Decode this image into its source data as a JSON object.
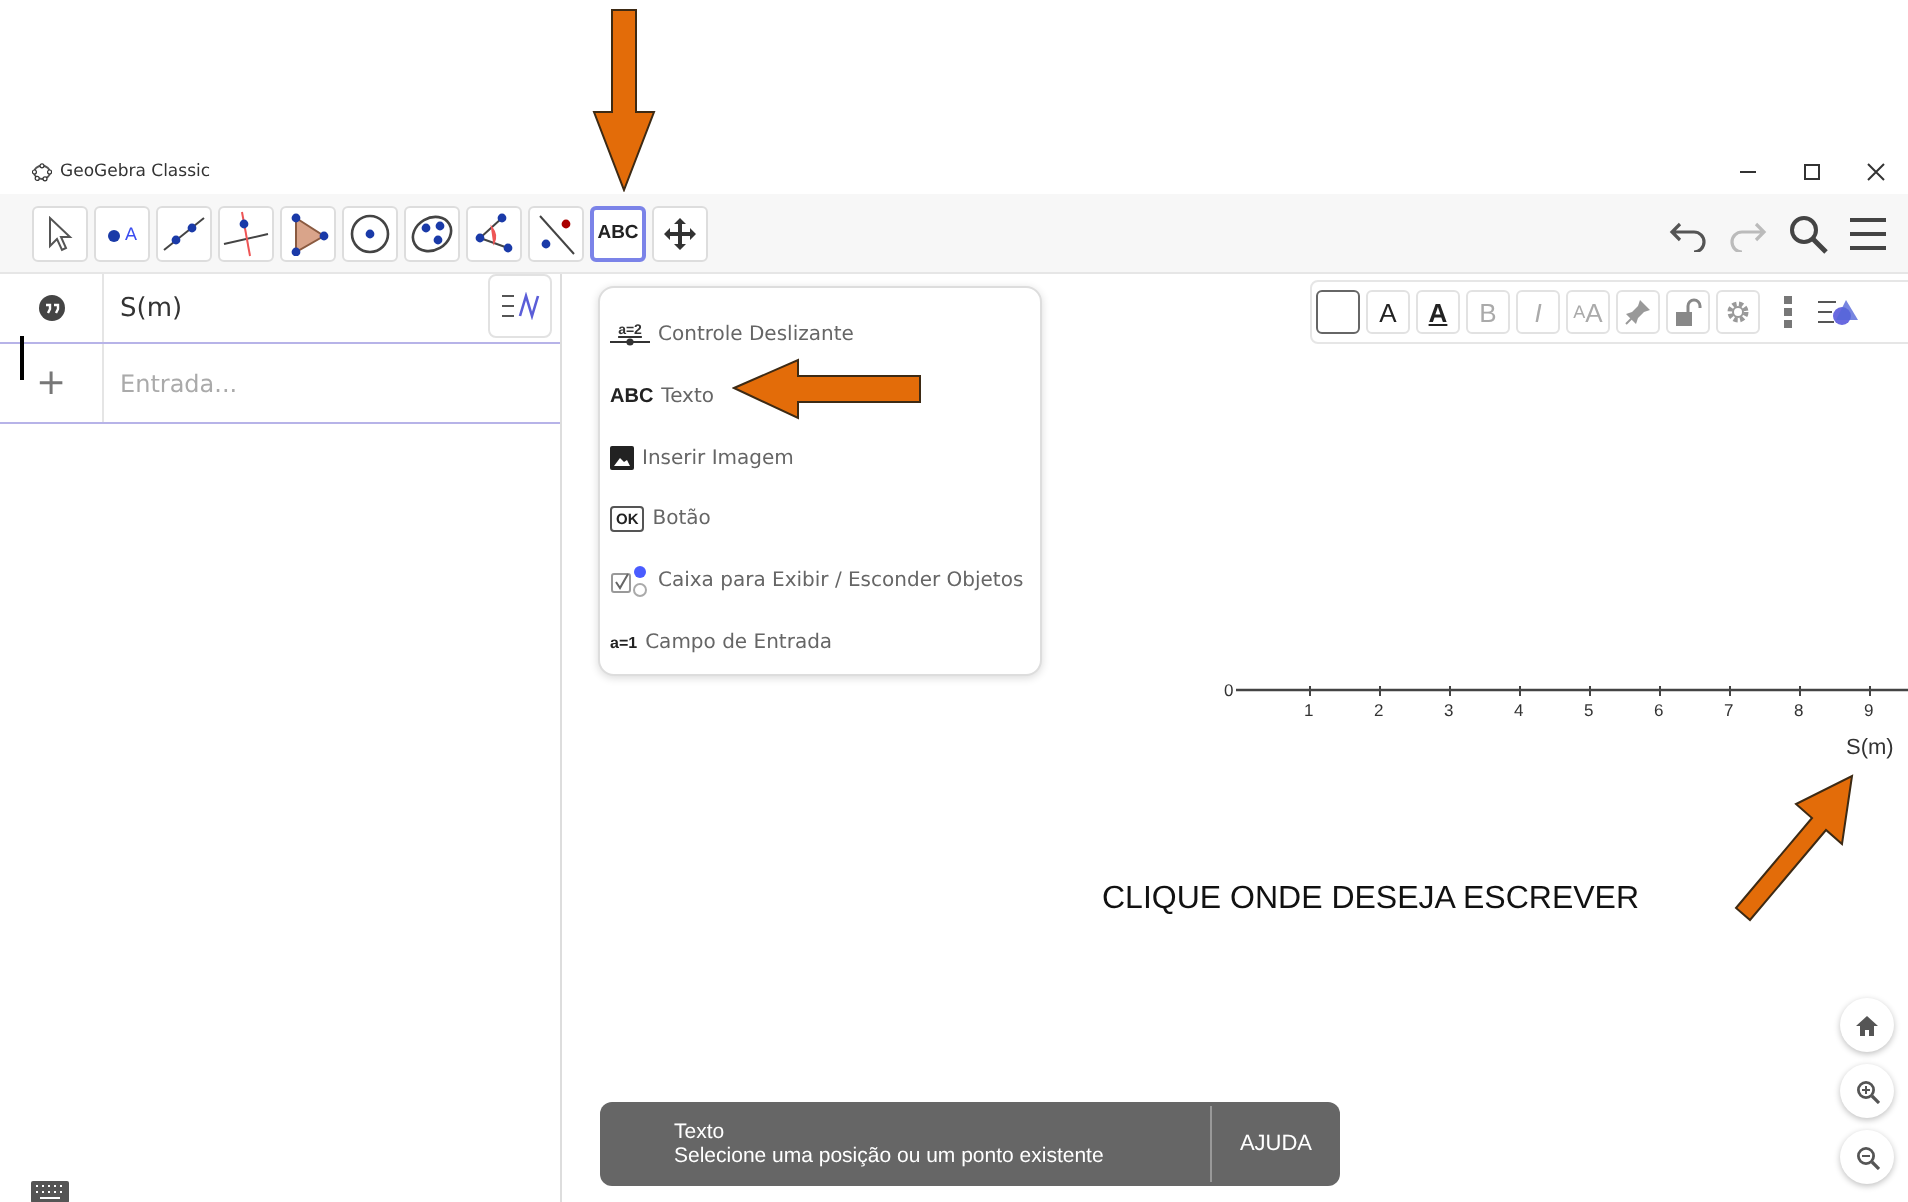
{
  "window": {
    "title": "GeoGebra Classic"
  },
  "toolbar": {
    "tools": [
      {
        "kind": "move",
        "selected": false
      },
      {
        "kind": "point",
        "label": "A",
        "selected": false
      },
      {
        "kind": "line",
        "selected": false
      },
      {
        "kind": "perpendicular",
        "selected": false
      },
      {
        "kind": "polygon",
        "selected": false
      },
      {
        "kind": "circle",
        "selected": false
      },
      {
        "kind": "conic",
        "selected": false
      },
      {
        "kind": "angle",
        "selected": false
      },
      {
        "kind": "reflect",
        "selected": false
      },
      {
        "kind": "text",
        "label": "ABC",
        "selected": true
      },
      {
        "kind": "move-view",
        "selected": false
      }
    ]
  },
  "algebra": {
    "rows": [
      {
        "kind": "object",
        "text": "S(m)"
      },
      {
        "kind": "input",
        "placeholder": "Entrada..."
      }
    ],
    "add_symbol": "+"
  },
  "tool_menu": {
    "items": [
      {
        "kind": "slider",
        "icon_text": "a=2",
        "label": "Controle Deslizante"
      },
      {
        "kind": "text",
        "icon_text": "ABC",
        "label": "Texto"
      },
      {
        "kind": "image",
        "label": "Inserir Imagem"
      },
      {
        "kind": "button",
        "icon_text": "OK",
        "label": "Botão"
      },
      {
        "kind": "checkbox",
        "label": "Caixa para Exibir / Esconder Objetos"
      },
      {
        "kind": "input",
        "icon_text": "a=1",
        "label": "Campo de Entrada"
      }
    ]
  },
  "style_bar": {
    "buttons": [
      {
        "kind": "color"
      },
      {
        "kind": "letter",
        "text": "A",
        "disabled": false
      },
      {
        "kind": "underline",
        "text": "A",
        "disabled": false
      },
      {
        "kind": "letter",
        "text": "B",
        "disabled": true
      },
      {
        "kind": "italic",
        "text": "I",
        "disabled": true
      },
      {
        "kind": "size",
        "text": "AA",
        "disabled": true
      },
      {
        "kind": "pin",
        "disabled": true
      },
      {
        "kind": "lock",
        "disabled": true
      },
      {
        "kind": "gear",
        "disabled": true
      }
    ]
  },
  "graphics": {
    "axis": {
      "origin_label": "0",
      "tick_labels": [
        "1",
        "2",
        "3",
        "4",
        "5",
        "6",
        "7",
        "8",
        "9"
      ],
      "label": "S(m)"
    }
  },
  "annotation": {
    "text": "CLIQUE ONDE DESEJA ESCREVER"
  },
  "help_toast": {
    "title": "Texto",
    "message": "Selecione uma posição ou um ponto existente",
    "button": "AJUDA"
  }
}
